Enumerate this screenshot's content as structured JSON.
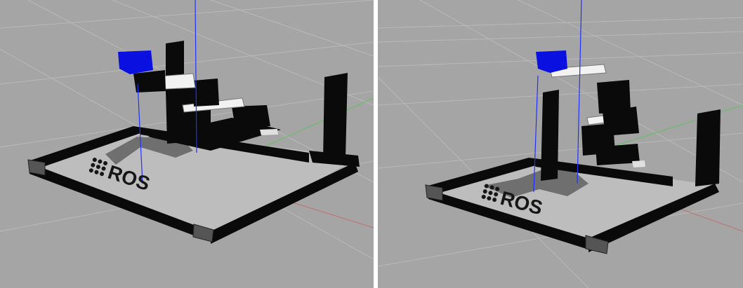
{
  "scenes": [
    {
      "id": "left",
      "logo_text": "ROS",
      "background": "#a5a5a5"
    },
    {
      "id": "right",
      "logo_text": "ROS",
      "background": "#a5a5a5"
    }
  ],
  "colors": {
    "ground": "#a5a5a5",
    "grid": "#b8b8b8",
    "frame": "#0a0a0a",
    "plate": "#bdbdbd",
    "gripper": "#0a10e0",
    "link_white": "#f2f2f2",
    "axis_blue": "#2030ff",
    "axis_red": "#c07070",
    "axis_green": "#60c060",
    "shadow": "#6f6f6f"
  }
}
